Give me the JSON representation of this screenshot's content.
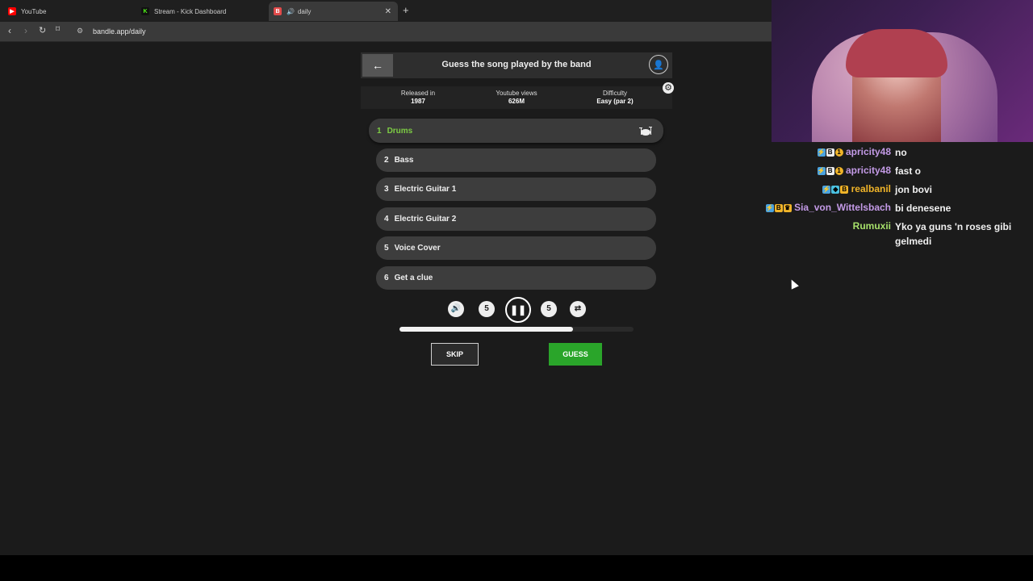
{
  "browser": {
    "tabs": [
      {
        "label": "YouTube",
        "icon": "youtube-icon",
        "color": "#ff0000"
      },
      {
        "label": "Stream - Kick Dashboard",
        "icon": "kick-icon",
        "color": "#53fc18"
      },
      {
        "label": "daily",
        "icon": "bandle-icon",
        "color": "#e24a4a",
        "active": true
      }
    ],
    "url": "bandle.app/daily"
  },
  "game": {
    "title": "Guess the song played by the band",
    "info": [
      {
        "label": "Released in",
        "value": "1987"
      },
      {
        "label": "Youtube views",
        "value": "626M"
      },
      {
        "label": "Difficulty",
        "value": "Easy (par 2)"
      }
    ],
    "tracks": [
      {
        "num": "1",
        "label": "Drums",
        "active": true
      },
      {
        "num": "2",
        "label": "Bass"
      },
      {
        "num": "3",
        "label": "Electric Guitar 1"
      },
      {
        "num": "4",
        "label": "Electric Guitar 2"
      },
      {
        "num": "5",
        "label": "Voice Cover"
      },
      {
        "num": "6",
        "label": "Get a clue"
      }
    ],
    "controls": [
      "volume-icon",
      "rewind-5-icon",
      "pause-icon",
      "forward-5-icon",
      "repeat-icon"
    ],
    "progress": 0.74,
    "skip_label": "SKIP",
    "guess_label": "GUESS",
    "accent": "#7dcc44",
    "guess_color": "#2aa52a"
  },
  "chat": {
    "messages": [
      {
        "user": "apricity48",
        "text": "no",
        "user_color": "#c39ae6"
      },
      {
        "user": "apricity48",
        "text": "fast o",
        "user_color": "#c39ae6"
      },
      {
        "user": "realbanil",
        "text": "jon bovi",
        "user_color": "#f0b429"
      },
      {
        "user": "Sia_von_Wittelsbach",
        "text": "bi denesene",
        "user_color": "#c39ae6"
      },
      {
        "user": "Rumuxii",
        "text": "Yko ya guns 'n roses gibi gelmedi",
        "user_color": "#a6e06a"
      }
    ]
  }
}
